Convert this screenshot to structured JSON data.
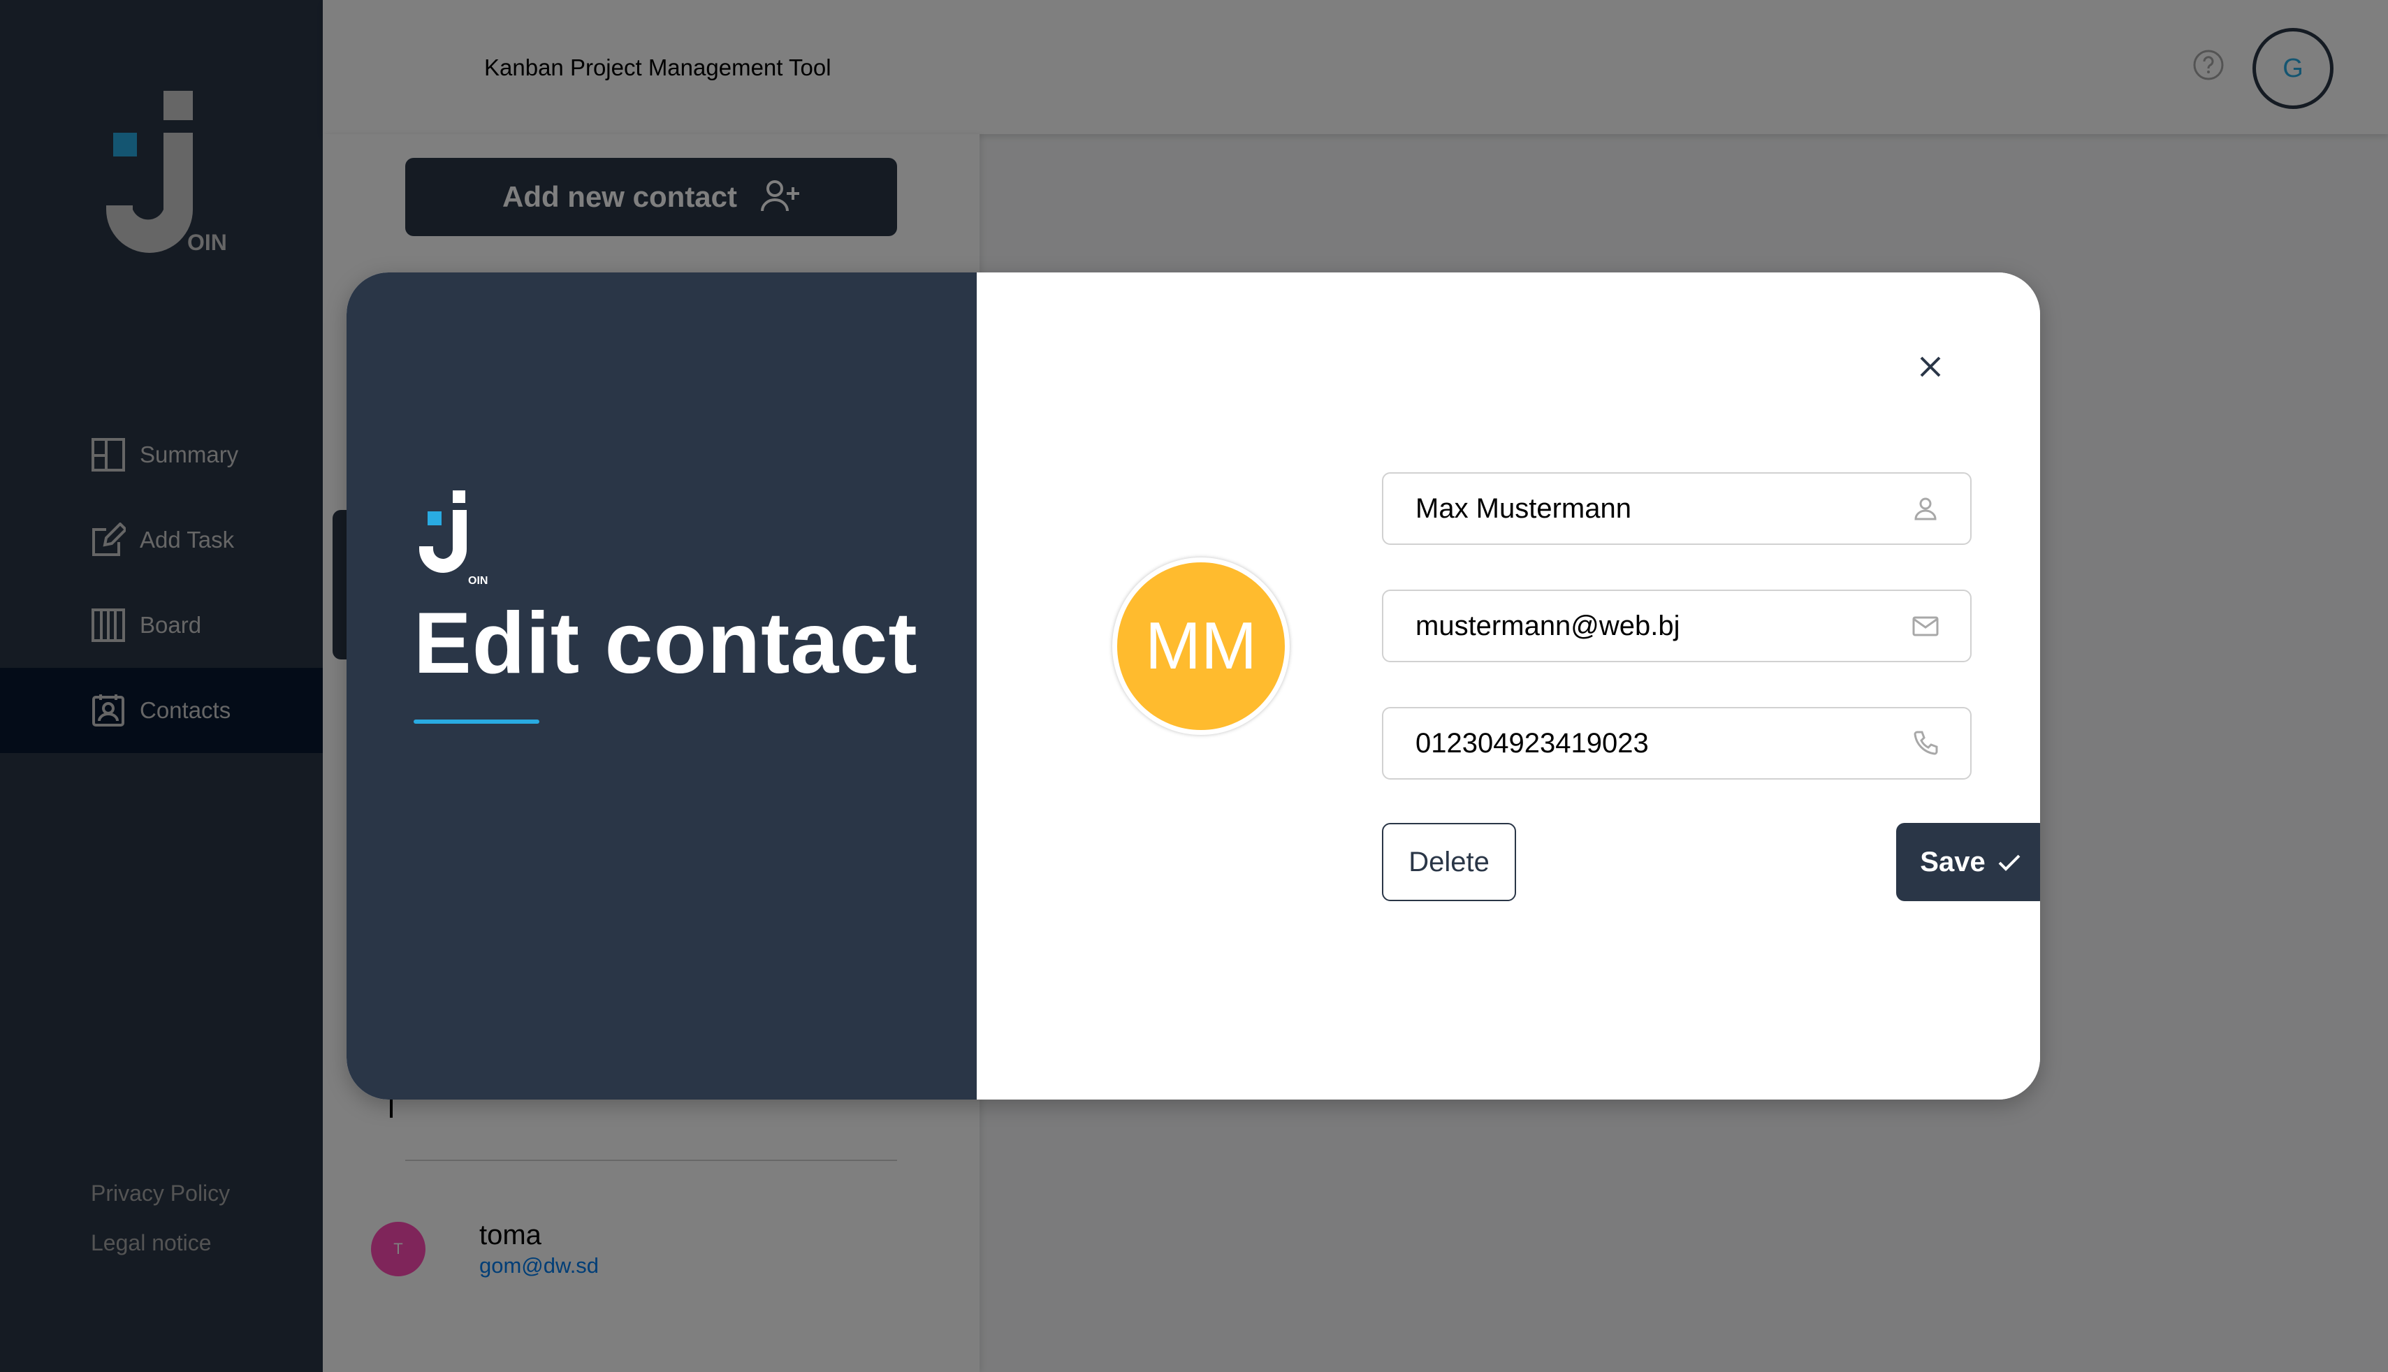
{
  "app": {
    "logo_text": "OIN",
    "header_title": "Kanban Project Management Tool",
    "user_initial": "G",
    "help_icon": "help-circle-icon"
  },
  "sidebar": {
    "items": [
      {
        "label": "Summary",
        "icon": "summary-icon",
        "active": false
      },
      {
        "label": "Add Task",
        "icon": "add-task-icon",
        "active": false
      },
      {
        "label": "Board",
        "icon": "board-icon",
        "active": false
      },
      {
        "label": "Contacts",
        "icon": "contacts-icon",
        "active": true
      }
    ],
    "footer_links": [
      "Privacy Policy",
      "Legal notice"
    ]
  },
  "contacts_panel": {
    "add_button_label": "Add new contact",
    "contacts": [
      {
        "initials": "T",
        "name": "toma",
        "email": "gom@dw.sd",
        "color": "#ff4bb5"
      }
    ]
  },
  "modal": {
    "title": "Edit contact",
    "logo_text": "OIN",
    "avatar_initials": "MM",
    "avatar_color": "#ffbb2e",
    "name_value": "Max Mustermann",
    "email_value": "mustermann@web.bj",
    "phone_value": "012304923419023",
    "delete_label": "Delete",
    "save_label": "Save"
  },
  "colors": {
    "primary_dark": "#2a3647",
    "accent_blue": "#29abe2",
    "active_nav": "#091931"
  }
}
